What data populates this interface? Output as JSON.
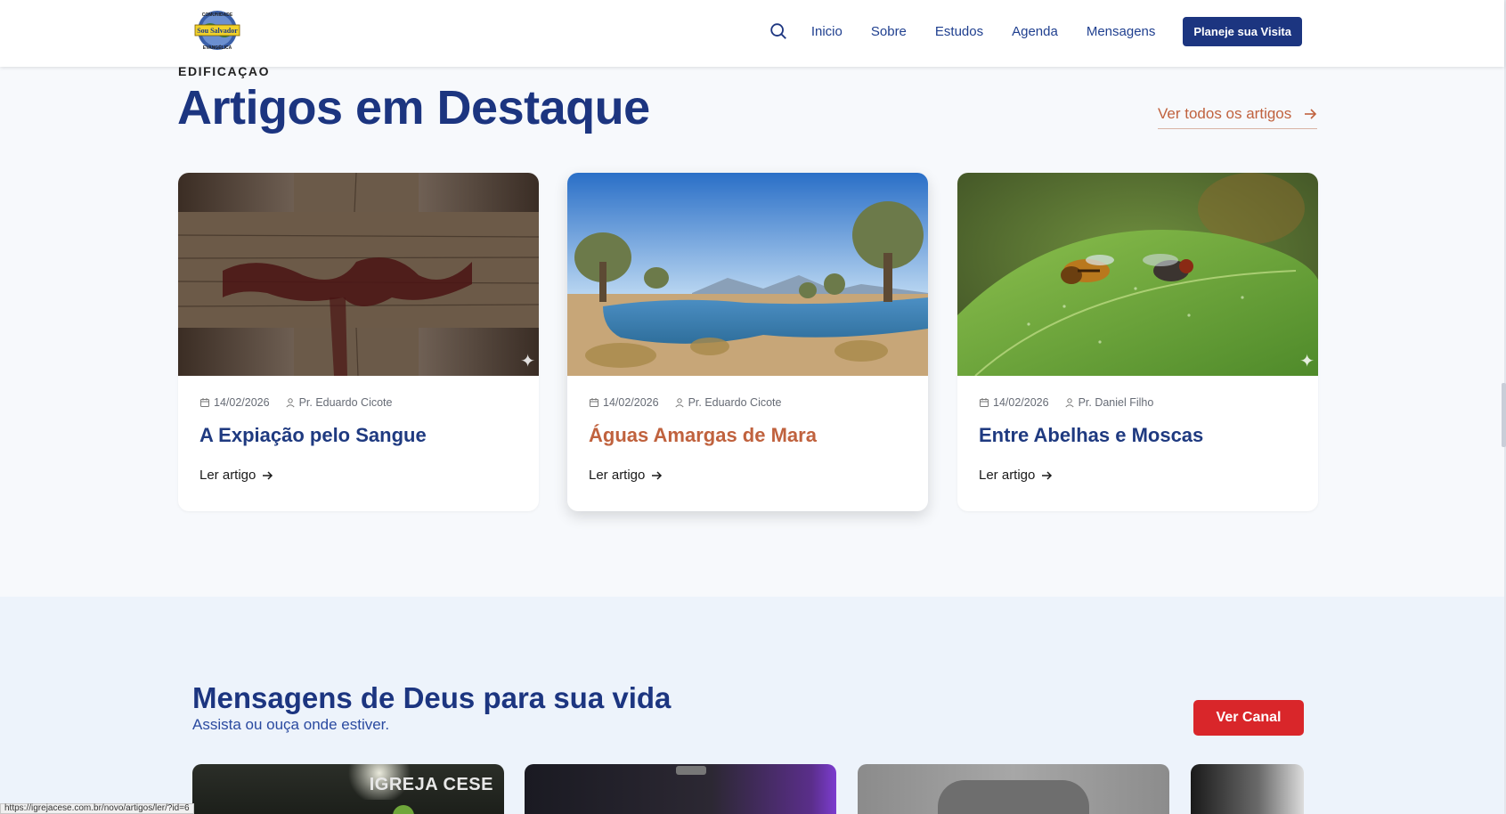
{
  "header": {
    "nav": [
      "Inicio",
      "Sobre",
      "Estudos",
      "Agenda",
      "Mensagens"
    ],
    "cta": "Planeje sua Visita",
    "search_icon": "search-icon",
    "logo_text_top": "COMUNIDADE",
    "logo_text_center": "Sou Salvador",
    "logo_text_bottom": "EVANGÉLICA"
  },
  "articles": {
    "kicker": "EDIFICAÇÃO",
    "title": "Artigos em Destaque",
    "see_all": "Ver todos os artigos",
    "items": [
      {
        "date": "14/02/2026",
        "author": "Pr. Eduardo Cicote",
        "title": "A Expiação pelo Sangue",
        "read": "Ler artigo"
      },
      {
        "date": "14/02/2026",
        "author": "Pr. Eduardo Cicote",
        "title": "Águas Amargas de Mara",
        "read": "Ler artigo"
      },
      {
        "date": "14/02/2026",
        "author": "Pr. Daniel Filho",
        "title": "Entre Abelhas e Moscas",
        "read": "Ler artigo"
      }
    ]
  },
  "messages": {
    "title": "Mensagens de Deus para sua vida",
    "subtitle": "Assista ou ouça onde estiver.",
    "button": "Ver Canal",
    "thumb1_brand": "IGREJA CESE"
  },
  "status_url": "https://igrejacese.com.br/novo/artigos/ler/?id=6",
  "colors": {
    "primary": "#1c3580",
    "accent": "#c0623e",
    "red": "#d9262a"
  }
}
